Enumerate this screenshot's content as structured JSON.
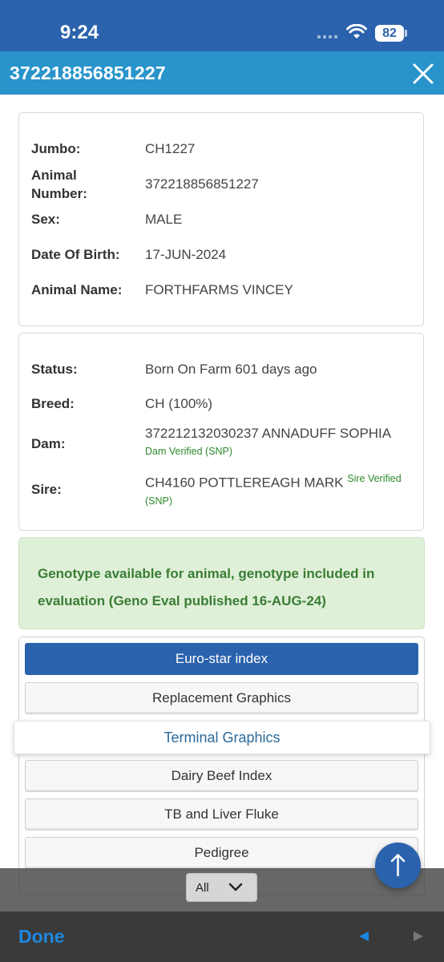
{
  "status_bar": {
    "time": "9:24",
    "battery": "82"
  },
  "header": {
    "title": "372218856851227"
  },
  "identity": {
    "rows": [
      {
        "label": "Jumbo:",
        "value": "CH1227"
      },
      {
        "label": "Animal Number:",
        "value": "372218856851227"
      },
      {
        "label": "Sex:",
        "value": "MALE"
      },
      {
        "label": "Date Of Birth:",
        "value": "17-JUN-2024"
      },
      {
        "label": "Animal Name:",
        "value": "FORTHFARMS VINCEY"
      }
    ]
  },
  "details": {
    "status_label": "Status:",
    "status_value": "Born On Farm 601 days ago",
    "breed_label": "Breed:",
    "breed_value": "CH (100%)",
    "dam_label": "Dam:",
    "dam_value": "372212132030237 ANNADUFF SOPHIA",
    "dam_verified": "Dam Verified (SNP)",
    "sire_label": "Sire:",
    "sire_value": "CH4160 POTTLEREAGH MARK",
    "sire_verified_1": "Sire Verified",
    "sire_verified_2": "(SNP)"
  },
  "genotype": {
    "line1": "Genotype available for animal, genotype included in",
    "line2": "evaluation (Geno Eval published 16-AUG-24)"
  },
  "menu": {
    "items": [
      "Euro-star index",
      "Replacement Graphics",
      "Terminal Graphics",
      "Dairy Beef Index",
      "TB and Liver Fluke",
      "Pedigree"
    ]
  },
  "picker": {
    "selected": "All"
  },
  "toolbar": {
    "done_label": "Done"
  },
  "colors": {
    "primary": "#2b62ad",
    "header": "#2994cc",
    "success_bg": "#dff0d8",
    "success_text": "#3a7d35",
    "link": "#1d87e0"
  },
  "icons": {
    "close": "close-icon",
    "wifi": "wifi-icon",
    "scroll_top": "arrow-up-icon",
    "prev": "prev-arrow-icon",
    "next": "next-arrow-icon",
    "chevron": "chevron-down-icon"
  }
}
